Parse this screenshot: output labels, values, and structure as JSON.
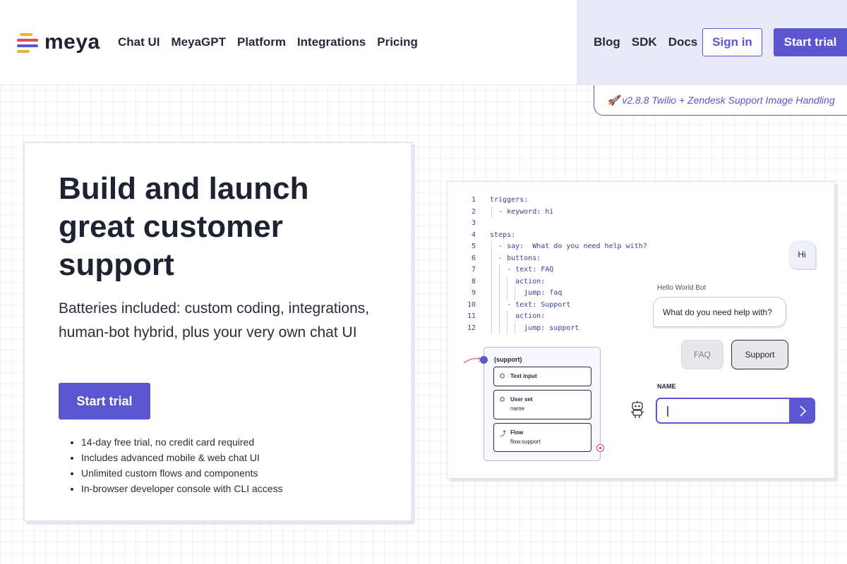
{
  "brand": {
    "logo_text": "meya",
    "logo_colors": [
      "#e8b33a",
      "#e5475c",
      "#5b55cf"
    ]
  },
  "nav": {
    "left": [
      "Chat UI",
      "MeyaGPT",
      "Platform",
      "Integrations",
      "Pricing"
    ],
    "right": [
      "Blog",
      "SDK",
      "Docs"
    ],
    "signin_label": "Sign in",
    "trial_label": "Start trial"
  },
  "release": {
    "text": "🚀 v2.8.8 Twilio + Zendesk Support Image Handling"
  },
  "hero": {
    "title": "Build and launch great customer support",
    "subtitle": "Batteries included: custom coding, integrations, human-bot hybrid, plus your very own chat UI",
    "cta_label": "Start trial",
    "features": [
      "14-day free trial, no credit card required",
      "Includes advanced mobile & web chat UI",
      "Unlimited custom flows and components",
      "In-browser developer console with CLI access"
    ]
  },
  "demo": {
    "code_lines": [
      {
        "n": "1",
        "text": "triggers:"
      },
      {
        "n": "2",
        "text": "  - keyword: hi"
      },
      {
        "n": "3",
        "text": ""
      },
      {
        "n": "4",
        "text": "steps:"
      },
      {
        "n": "5",
        "text": "  - say:  What do you need help with?"
      },
      {
        "n": "6",
        "text": "  - buttons:"
      },
      {
        "n": "7",
        "text": "    - text: FAQ"
      },
      {
        "n": "8",
        "text": "      action:"
      },
      {
        "n": "9",
        "text": "        jump: faq"
      },
      {
        "n": "10",
        "text": "    - text: Support"
      },
      {
        "n": "11",
        "text": "      action:"
      },
      {
        "n": "12",
        "text": "        jump: support"
      }
    ],
    "flow": {
      "title": "(support)",
      "items": [
        {
          "label": "Text input",
          "sub": "",
          "icon": "component-icon"
        },
        {
          "label": "User set",
          "sub": "name",
          "icon": "component-icon"
        },
        {
          "label": "Flow",
          "sub": "flow.support",
          "icon": "flow-icon"
        }
      ]
    },
    "chat": {
      "user_message": "Hi",
      "bot_name": "Hello World Bot",
      "bot_message": "What do you need help with?",
      "quick_replies": [
        "FAQ",
        "Support"
      ],
      "field_label": "NAME",
      "accent": "#5b55cf"
    }
  }
}
